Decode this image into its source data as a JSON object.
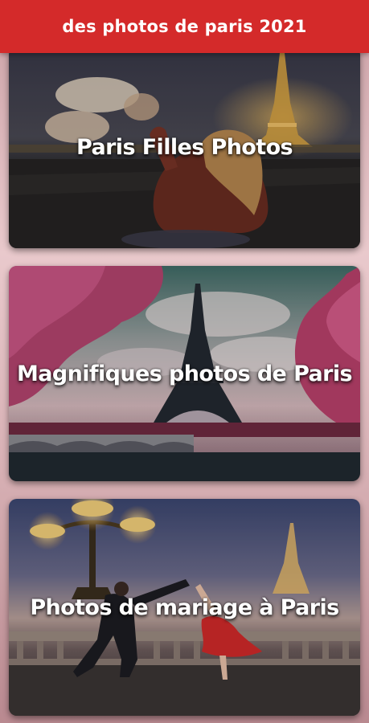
{
  "app_bar": {
    "title": "des photos de paris 2021"
  },
  "cards": [
    {
      "label": "Paris Filles Photos"
    },
    {
      "label": "Magnifiques photos de Paris"
    },
    {
      "label": "Photos de mariage à Paris"
    }
  ],
  "colors": {
    "app_bar": "#d42a2a",
    "label_text": "#ffffff"
  }
}
